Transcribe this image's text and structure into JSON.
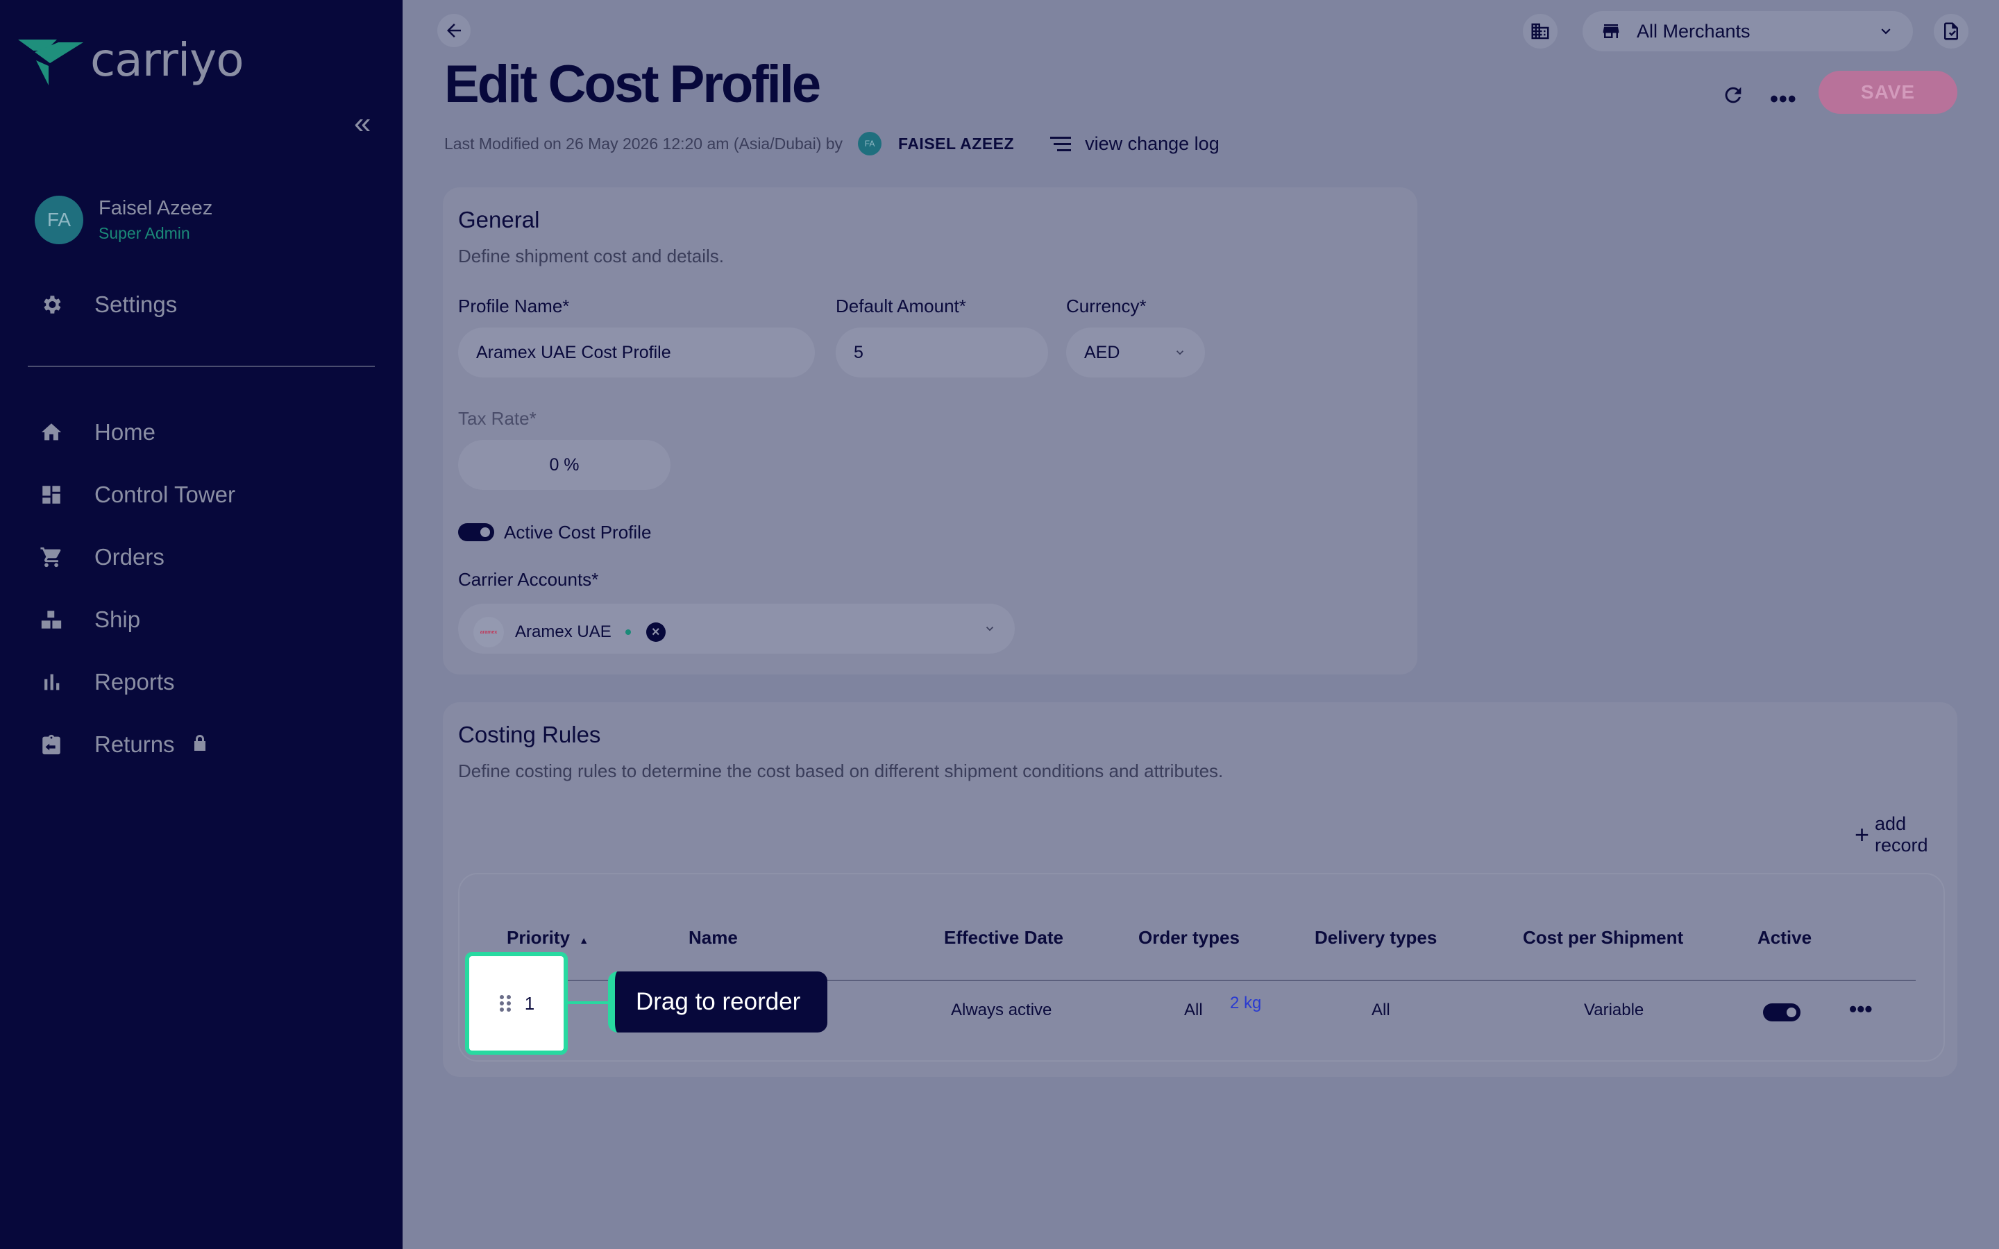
{
  "brand": {
    "name": "carriyo",
    "accent": "#28d9a0",
    "sidebar_bg": "#07083b"
  },
  "sidebar": {
    "user": {
      "initials": "FA",
      "name": "Faisel Azeez",
      "role": "Super Admin"
    },
    "settings_label": "Settings",
    "items": [
      {
        "label": "Home",
        "icon": "home-icon"
      },
      {
        "label": "Control Tower",
        "icon": "dashboard-icon"
      },
      {
        "label": "Orders",
        "icon": "cart-icon"
      },
      {
        "label": "Ship",
        "icon": "boxes-icon"
      },
      {
        "label": "Reports",
        "icon": "bar-chart-icon"
      },
      {
        "label": "Returns",
        "icon": "return-box-icon",
        "locked": true
      }
    ]
  },
  "topbar": {
    "merchant_select": "All Merchants"
  },
  "page": {
    "title": "Edit Cost Profile",
    "modified_text": "Last Modified on 26 May 2026 12:20 am (Asia/Dubai) by",
    "modified_by_initials": "FA",
    "modified_by": "FAISEL AZEEZ",
    "change_log": "view change log",
    "save_label": "SAVE"
  },
  "general": {
    "title": "General",
    "subtitle": "Define shipment cost and details.",
    "profile_name_label": "Profile Name*",
    "profile_name_value": "Aramex UAE Cost Profile",
    "default_amount_label": "Default Amount*",
    "default_amount_value": "5",
    "currency_label": "Currency*",
    "currency_value": "AED",
    "tax_rate_label": "Tax Rate*",
    "tax_rate_value": "0 %",
    "active_label": "Active Cost Profile",
    "active": true,
    "carrier_label": "Carrier Accounts*",
    "carrier_chip": "Aramex UAE",
    "carrier_logo_text": "aramex"
  },
  "rules": {
    "title": "Costing Rules",
    "subtitle": "Define costing rules to determine the cost based on different shipment conditions and attributes.",
    "add_record": "add record",
    "columns": [
      "Priority",
      "Name",
      "Effective Date",
      "Order types",
      "Delivery types",
      "Cost per Shipment",
      "Active"
    ],
    "rows": [
      {
        "priority": "1",
        "name_visible": "2 kg",
        "effective_date": "Always active",
        "order_types": "All",
        "delivery_types": "All",
        "cost": "Variable",
        "active": true
      }
    ]
  },
  "tooltip": {
    "text": "Drag to reorder"
  }
}
